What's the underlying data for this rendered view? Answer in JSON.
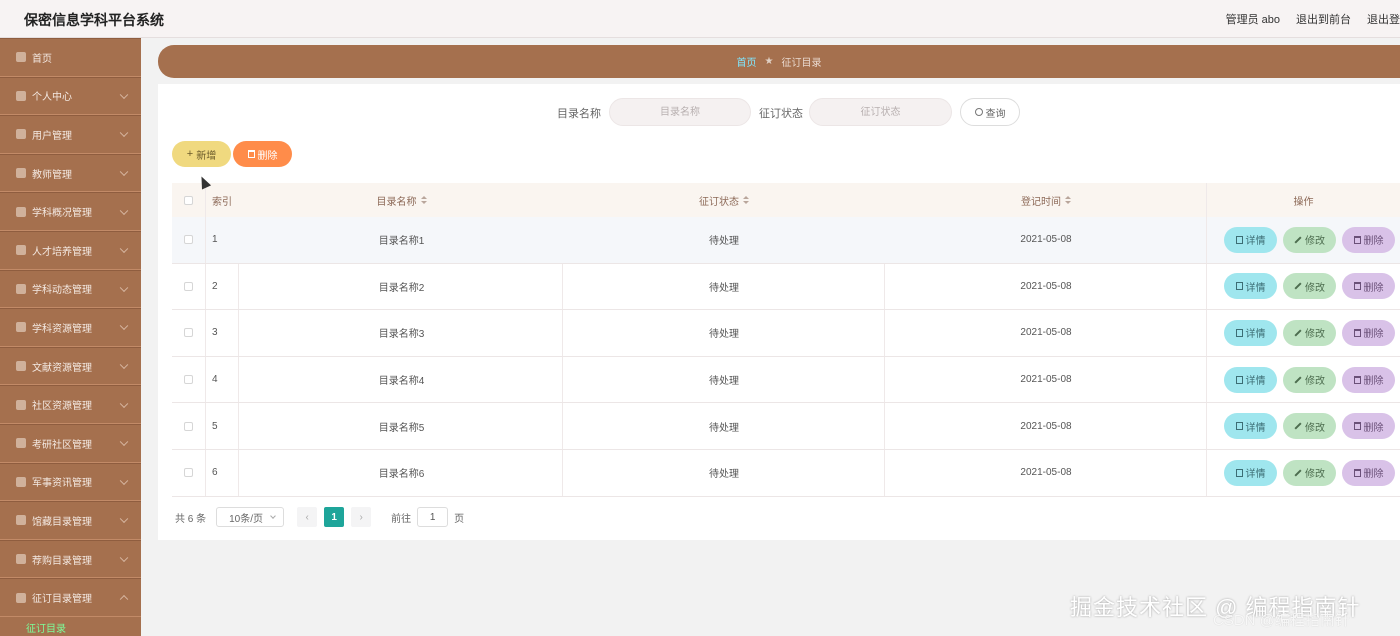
{
  "header": {
    "app_title": "保密信息学科平台系统",
    "user_label": "管理员 abo",
    "to_front": "退出到前台",
    "logout": "退出登"
  },
  "sidebar": {
    "items": [
      {
        "label": "首页",
        "icon": "home-icon"
      },
      {
        "label": "个人中心",
        "icon": "user-icon"
      },
      {
        "label": "用户管理",
        "icon": "users-icon"
      },
      {
        "label": "教师管理",
        "icon": "teacher-icon"
      },
      {
        "label": "学科概况管理",
        "icon": "overview-icon"
      },
      {
        "label": "人才培养管理",
        "icon": "talent-icon"
      },
      {
        "label": "学科动态管理",
        "icon": "news-icon"
      },
      {
        "label": "学科资源管理",
        "icon": "resource-icon"
      },
      {
        "label": "文献资源管理",
        "icon": "book-icon"
      },
      {
        "label": "社区资源管理",
        "icon": "community-icon"
      },
      {
        "label": "考研社区管理",
        "icon": "grid-icon"
      },
      {
        "label": "军事资讯管理",
        "icon": "military-icon"
      },
      {
        "label": "馆藏目录管理",
        "icon": "library-icon"
      },
      {
        "label": "荐购目录管理",
        "icon": "recommend-icon"
      },
      {
        "label": "征订目录管理",
        "icon": "subscribe-icon"
      }
    ],
    "active_sub": "征订目录"
  },
  "breadcrumb": {
    "home": "首页",
    "sep": "★",
    "current": "征订目录"
  },
  "search": {
    "name_label": "目录名称",
    "name_placeholder": "目录名称",
    "status_label": "征订状态",
    "status_placeholder": "征订状态",
    "query_label": "查询"
  },
  "actions": {
    "add_label": "新增",
    "delete_label": "删除"
  },
  "table": {
    "columns": [
      "索引",
      "目录名称",
      "征订状态",
      "登记时间",
      "操作"
    ],
    "ops": {
      "detail": "详情",
      "edit": "修改",
      "delete": "删除"
    },
    "rows": [
      {
        "idx": "1",
        "name": "目录名称1",
        "status": "待处理",
        "time": "2021-05-08"
      },
      {
        "idx": "2",
        "name": "目录名称2",
        "status": "待处理",
        "time": "2021-05-08"
      },
      {
        "idx": "3",
        "name": "目录名称3",
        "status": "待处理",
        "time": "2021-05-08"
      },
      {
        "idx": "4",
        "name": "目录名称4",
        "status": "待处理",
        "time": "2021-05-08"
      },
      {
        "idx": "5",
        "name": "目录名称5",
        "status": "待处理",
        "time": "2021-05-08"
      },
      {
        "idx": "6",
        "name": "目录名称6",
        "status": "待处理",
        "time": "2021-05-08"
      }
    ]
  },
  "pagination": {
    "total": "共 6 条",
    "page_size": "10条/页",
    "prev": "‹",
    "current_page": "1",
    "next": "›",
    "goto_label": "前往",
    "goto_value": "1",
    "page_unit": "页"
  },
  "watermark": {
    "line1": "掘金技术社区 @ 编程指南针",
    "line2": "CSDN @编程指南针"
  }
}
